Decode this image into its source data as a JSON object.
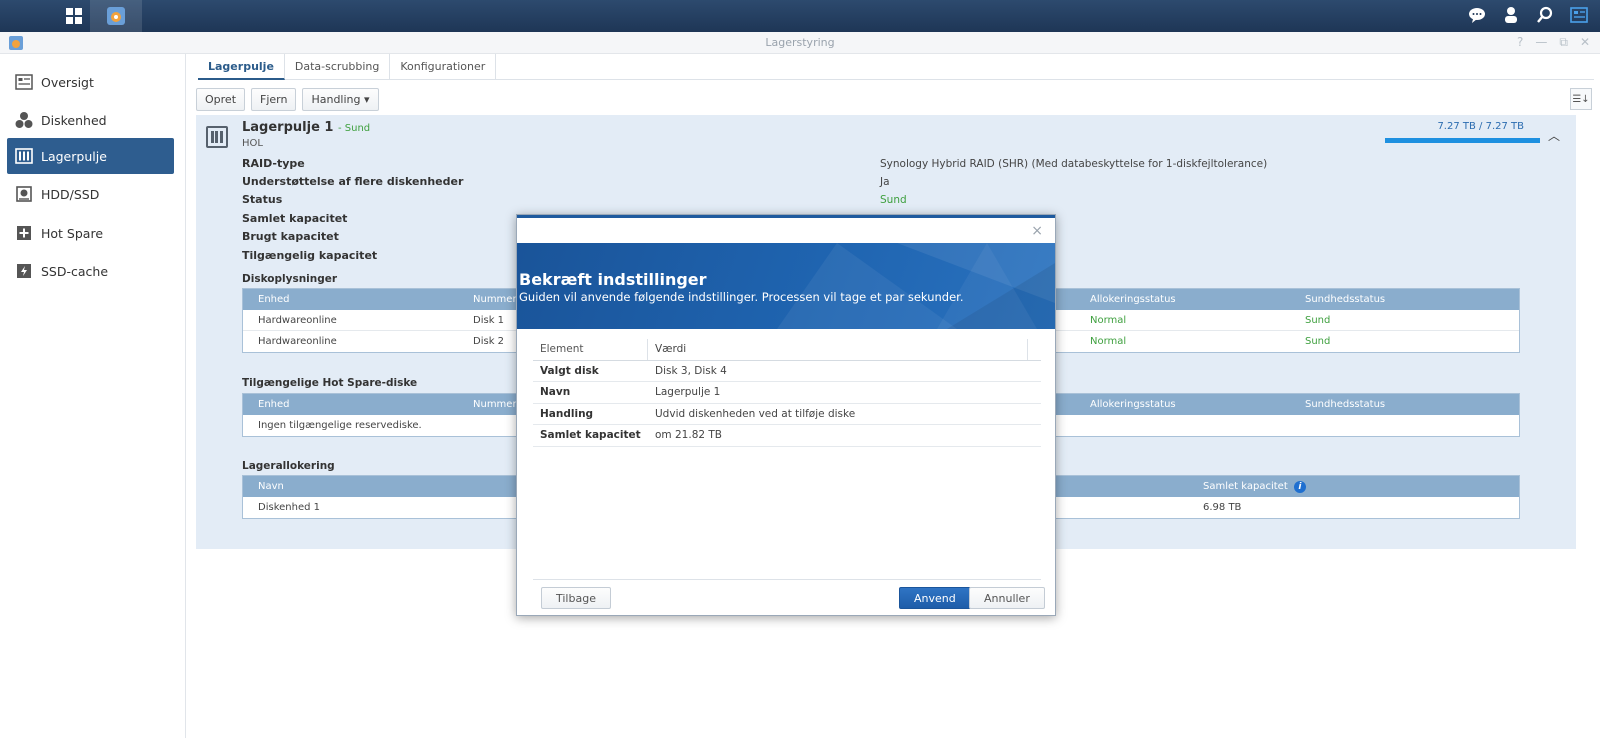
{
  "window": {
    "title": "Lagerstyring",
    "controls": [
      "?",
      "—",
      "⧉",
      "✕"
    ]
  },
  "sidebar": {
    "items": [
      {
        "label": "Oversigt",
        "icon": "overview-icon"
      },
      {
        "label": "Diskenhed",
        "icon": "volume-icon"
      },
      {
        "label": "Lagerpulje",
        "icon": "storage-pool-icon",
        "active": true
      },
      {
        "label": "HDD/SSD",
        "icon": "hdd-icon"
      },
      {
        "label": "Hot Spare",
        "icon": "hot-spare-icon"
      },
      {
        "label": "SSD-cache",
        "icon": "ssd-cache-icon"
      }
    ]
  },
  "tabs": [
    "Lagerpulje",
    "Data-scrubbing",
    "Konfigurationer"
  ],
  "toolbar": {
    "create": "Opret",
    "remove": "Fjern",
    "action": "Handling ▾"
  },
  "pool": {
    "name": "Lagerpulje 1",
    "status": "- Sund",
    "subtitle": "HOL",
    "capacity_text": "7.27 TB / 7.27 TB",
    "usage_fraction": 1.0,
    "props": {
      "raid_label": "RAID-type",
      "raid_value": "Synology Hybrid RAID (SHR) (Med databeskyttelse for 1-diskfejltolerance)",
      "multi_label": "Understøttelse af flere diskenheder",
      "multi_value": "Ja",
      "status_label": "Status",
      "status_value": "Sund",
      "total_label": "Samlet kapacitet",
      "used_label": "Brugt kapacitet",
      "avail_label": "Tilgængelig kapacitet"
    },
    "disk_info": {
      "title": "Diskoplysninger",
      "headers": [
        "Enhed",
        "Nummer",
        "Allokeringsstatus",
        "Sundhedsstatus"
      ],
      "rows": [
        [
          "Hardwareonline",
          "Disk 1",
          "Normal",
          "Sund"
        ],
        [
          "Hardwareonline",
          "Disk 2",
          "Normal",
          "Sund"
        ]
      ]
    },
    "hot_spare": {
      "title": "Tilgængelige Hot Spare-diske",
      "headers": [
        "Enhed",
        "Nummer",
        "Allokeringsstatus",
        "Sundhedsstatus"
      ],
      "empty": "Ingen tilgængelige reservediske."
    },
    "allocation": {
      "title": "Lagerallokering",
      "headers": [
        "Navn",
        "Samlet kapacitet"
      ],
      "rows": [
        [
          "Diskenhed 1",
          "6.98 TB"
        ]
      ]
    }
  },
  "modal": {
    "close": "×",
    "title": "Bekræft indstillinger",
    "subtitle": "Guiden vil anvende følgende indstillinger. Processen vil tage et par sekunder.",
    "headers": [
      "Element",
      "Værdi"
    ],
    "rows": [
      [
        "Valgt disk",
        "Disk 3, Disk 4"
      ],
      [
        "Navn",
        "Lagerpulje 1"
      ],
      [
        "Handling",
        "Udvid diskenheden ved at tilføje diske"
      ],
      [
        "Samlet kapacitet",
        "om 21.82 TB"
      ]
    ],
    "back": "Tilbage",
    "apply": "Anvend",
    "cancel": "Annuller"
  },
  "colors": {
    "accent": "#2e5d8f",
    "ok": "#3fa03f",
    "banner": "#1f64b0"
  }
}
